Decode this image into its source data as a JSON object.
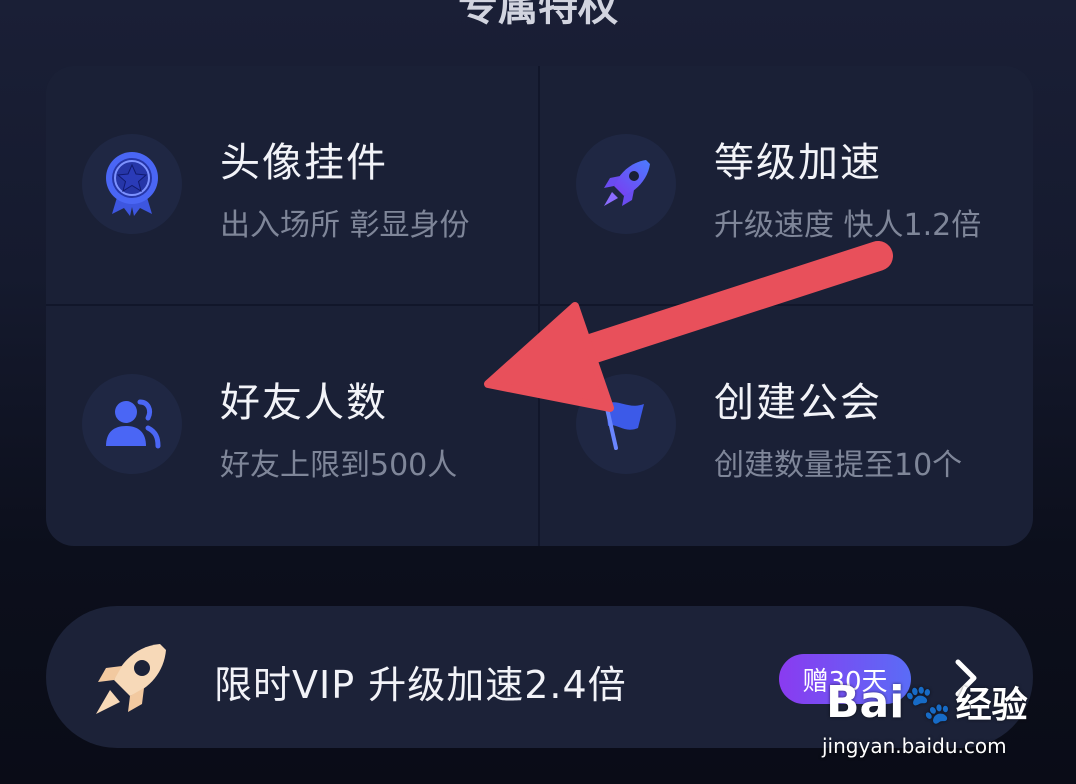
{
  "header": {
    "title": "专属特权"
  },
  "perks": [
    {
      "title": "头像挂件",
      "desc": "出入场所 彰显身份",
      "icon": "medal-star-icon"
    },
    {
      "title": "等级加速",
      "desc": "升级速度 快人1.2倍",
      "icon": "rocket-icon"
    },
    {
      "title": "好友人数",
      "desc": "好友上限到500人",
      "icon": "friends-icon"
    },
    {
      "title": "创建公会",
      "desc": "创建数量提至10个",
      "icon": "flag-icon"
    }
  ],
  "vip_bar": {
    "label": "限时VIP 升级加速2.4倍",
    "badge": "赠30天",
    "icon": "rocket-icon"
  },
  "watermark": {
    "logo": "Bai",
    "logo_suffix": "经验",
    "url": "jingyan.baidu.com"
  },
  "colors": {
    "background": "#13172a",
    "card": "#1a2036",
    "accent_purple": "#8a3bf0",
    "accent_blue": "#4a66f5",
    "annotation_arrow": "#e8505b"
  }
}
